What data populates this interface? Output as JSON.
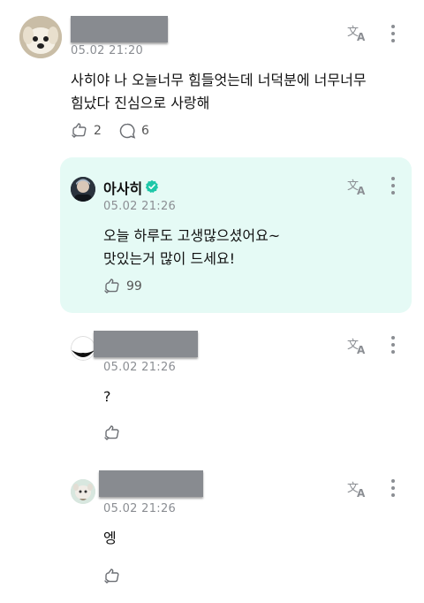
{
  "posts": [
    {
      "time": "05.02 21:20",
      "text_line1": "사히야 나 오늘너무 힘들엇는데 너덕분에 너무너무",
      "text_line2": "힘났다 진심으로 사랑해",
      "likes": "2",
      "comments": "6"
    },
    {
      "name": "아사히",
      "time": "05.02 21:26",
      "text_line1": "오늘 하루도 고생많으셨어요~",
      "text_line2": "맛있는거 많이 드세요!",
      "likes": "99"
    },
    {
      "time": "05.02 21:26",
      "text": "?"
    },
    {
      "time": "05.02 21:26",
      "text": "엥"
    }
  ],
  "colors": {
    "highlight_bg": "#e5faf5",
    "verified": "#1ec7a8",
    "muted": "#8b8e93",
    "redaction": "#888b90"
  },
  "icons": [
    "translate-icon",
    "more-vertical-icon",
    "like-icon",
    "comment-icon",
    "verified-badge-icon"
  ]
}
